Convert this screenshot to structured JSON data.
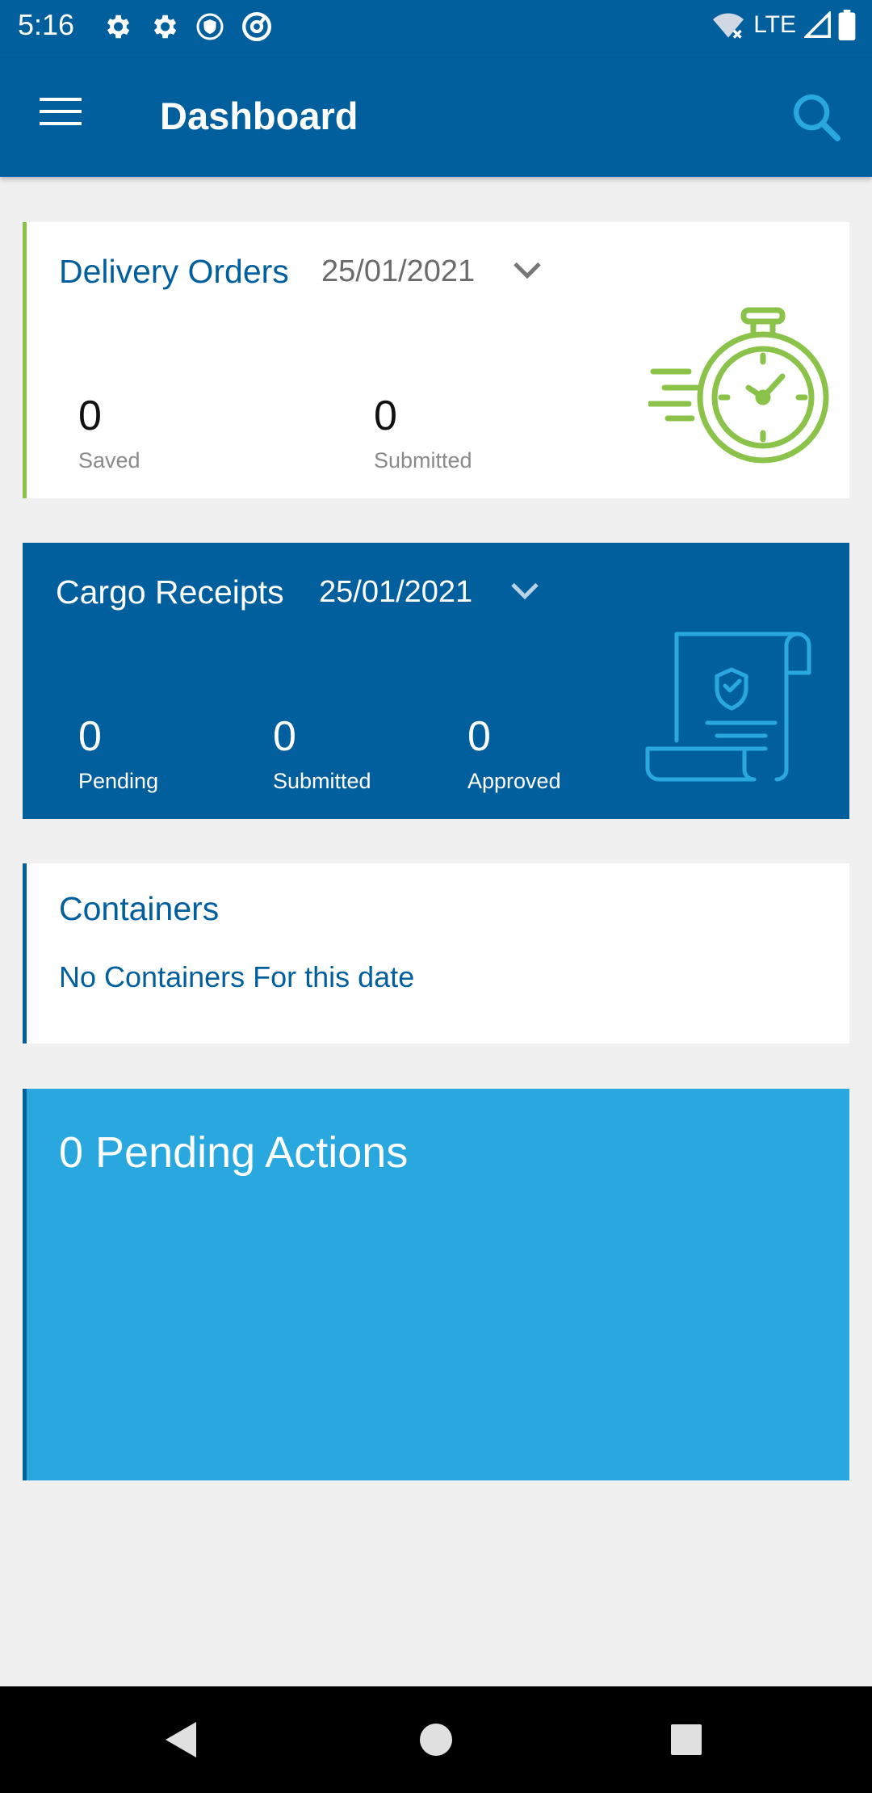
{
  "status_bar": {
    "time": "5:16",
    "network": "LTE",
    "icons": [
      "gear-icon",
      "gear-icon",
      "shield-icon",
      "at-sign-icon",
      "wifi-off-icon",
      "signal-icon",
      "battery-icon"
    ]
  },
  "app_bar": {
    "title": "Dashboard",
    "icons": [
      "menu-icon",
      "search-icon"
    ]
  },
  "delivery_orders": {
    "title": "Delivery Orders",
    "date": "25/01/2021",
    "stats": [
      {
        "value": "0",
        "label": "Saved"
      },
      {
        "value": "0",
        "label": "Submitted"
      }
    ],
    "accent_color": "#8bc34a",
    "icon": "stopwatch-icon"
  },
  "cargo_receipts": {
    "title": "Cargo Receipts",
    "date": "25/01/2021",
    "stats": [
      {
        "value": "0",
        "label": "Pending"
      },
      {
        "value": "0",
        "label": "Submitted"
      },
      {
        "value": "0",
        "label": "Approved"
      }
    ],
    "background_color": "#015f9e",
    "icon": "receipt-scroll-icon"
  },
  "containers": {
    "title": "Containers",
    "message": "No Containers For this date"
  },
  "pending_actions": {
    "title": "0 Pending Actions",
    "background_color": "#29a8e0"
  },
  "nav_bar": {
    "icons": [
      "back-icon",
      "home-icon",
      "recents-icon"
    ]
  }
}
